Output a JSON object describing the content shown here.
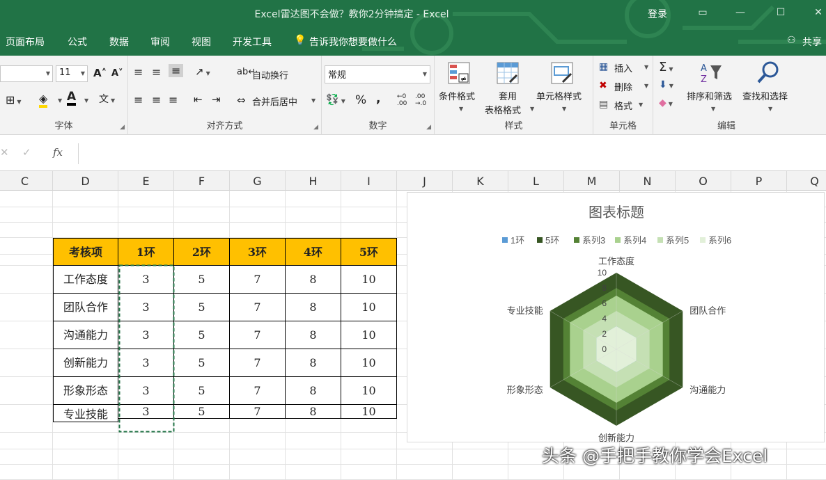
{
  "window": {
    "title": "Excel雷达图不会做？教你2分钟搞定  -  Excel",
    "login": "登录",
    "tabs": [
      "页面布局",
      "公式",
      "数据",
      "审阅",
      "视图",
      "开发工具"
    ],
    "tell_me": "告诉我你想要做什么",
    "share": "共享"
  },
  "ribbon": {
    "font": {
      "size": "11",
      "label": "字体"
    },
    "align": {
      "wrap": "自动换行",
      "merge": "合并后居中",
      "label": "对齐方式"
    },
    "number": {
      "format": "常规",
      "percent": "%",
      "comma": ",",
      "label": "数字"
    },
    "styles": {
      "cond": "条件格式",
      "table1": "套用",
      "table2": "表格格式",
      "cell": "单元格样式",
      "label": "样式"
    },
    "cells": {
      "insert": "插入",
      "delete": "删除",
      "format": "格式",
      "label": "单元格"
    },
    "editing": {
      "sort": "排序和筛选",
      "find": "查找和选择",
      "label": "编辑"
    }
  },
  "formula_bar": {
    "fx": "fx",
    "value": ""
  },
  "columns": [
    "C",
    "D",
    "E",
    "F",
    "G",
    "H",
    "I",
    "J",
    "K",
    "L",
    "M",
    "N",
    "O",
    "P",
    "Q"
  ],
  "table": {
    "headers": [
      "考核项",
      "1环",
      "2环",
      "3环",
      "4环",
      "5环"
    ],
    "rows": [
      [
        "工作态度",
        "3",
        "5",
        "7",
        "8",
        "10"
      ],
      [
        "团队合作",
        "3",
        "5",
        "7",
        "8",
        "10"
      ],
      [
        "沟通能力",
        "3",
        "5",
        "7",
        "8",
        "10"
      ],
      [
        "创新能力",
        "3",
        "5",
        "7",
        "8",
        "10"
      ],
      [
        "形象形态",
        "3",
        "5",
        "7",
        "8",
        "10"
      ],
      [
        "专业技能",
        "3",
        "5",
        "7",
        "8",
        "10"
      ]
    ]
  },
  "chart_data": {
    "type": "radar",
    "title": "图表标题",
    "categories": [
      "工作态度",
      "团队合作",
      "沟通能力",
      "创新能力",
      "形象形态",
      "专业技能"
    ],
    "axis": {
      "min": 0,
      "max": 10,
      "ticks": [
        "0",
        "2",
        "4",
        "6",
        "8",
        "10"
      ]
    },
    "series": [
      {
        "name": "1环",
        "color": "#5b9bd5",
        "values": [
          3,
          3,
          3,
          3,
          3,
          3
        ]
      },
      {
        "name": "5环",
        "color": "#375623",
        "values": [
          10,
          10,
          10,
          10,
          10,
          10
        ]
      },
      {
        "name": "系列3",
        "color": "#548235",
        "values": [
          8,
          8,
          8,
          8,
          8,
          8
        ]
      },
      {
        "name": "系列4",
        "color": "#a9d18e",
        "values": [
          7,
          7,
          7,
          7,
          7,
          7
        ]
      },
      {
        "name": "系列5",
        "color": "#c5e0b4",
        "values": [
          5,
          5,
          5,
          5,
          5,
          5
        ]
      },
      {
        "name": "系列6",
        "color": "#e2f0d9",
        "values": [
          3,
          3,
          3,
          3,
          3,
          3
        ]
      }
    ],
    "legend_position": "top"
  },
  "watermark": "头条 @手把手教你学会Excel"
}
